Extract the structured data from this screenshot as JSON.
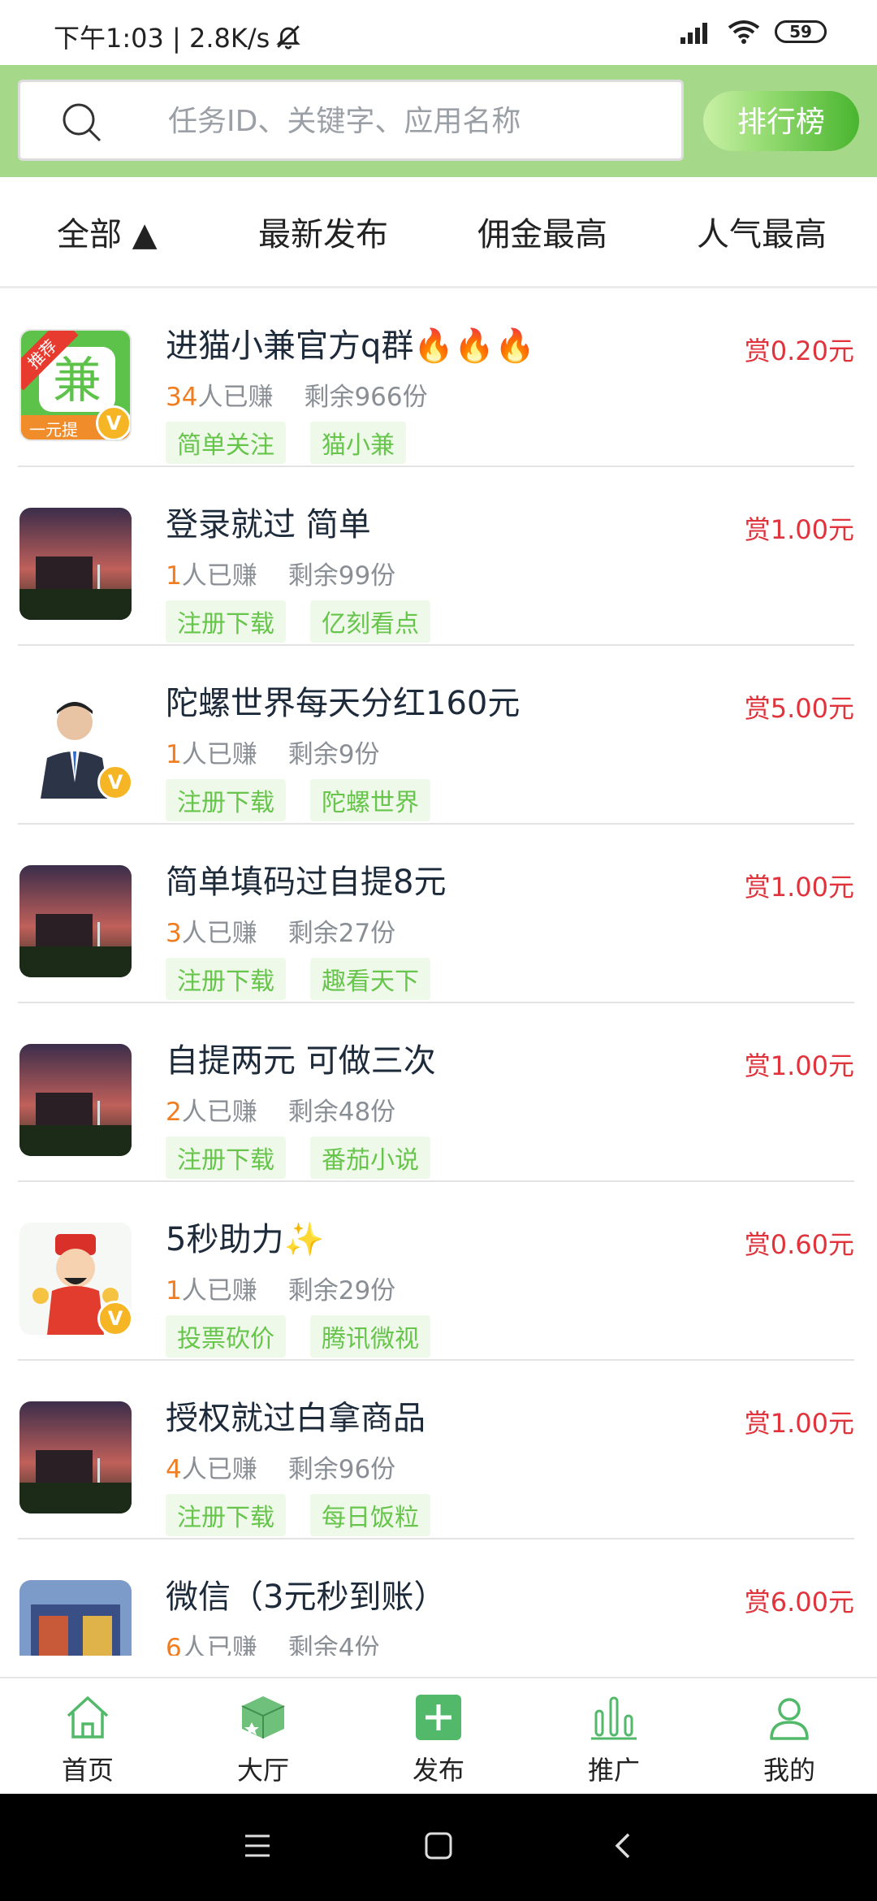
{
  "status_bar": {
    "left_text": "下午1:03 | 2.8K/s",
    "battery": "59",
    "icons": [
      "mute-bell-icon",
      "signal-icon",
      "wifi-icon",
      "battery-icon"
    ]
  },
  "search": {
    "placeholder": "任务ID、关键字、应用名称",
    "rank_button": "排行榜"
  },
  "tabs": [
    {
      "label": "全部 ▲"
    },
    {
      "label": "最新发布"
    },
    {
      "label": "佣金最高"
    },
    {
      "label": "人气最高"
    }
  ],
  "tasks": [
    {
      "title": "进猫小兼官方q群",
      "title_suffix": "🔥🔥🔥",
      "reward": "赏0.20元",
      "count": "34",
      "earned_label": "人已赚",
      "remain": "剩余966份",
      "tags": [
        "简单关注",
        "猫小兼"
      ],
      "thumb": "app-logo-jian",
      "ribbon": "推荐",
      "thumb_caption": "一元提"
    },
    {
      "title": "登录就过 简单",
      "title_suffix": "",
      "reward": "赏1.00元",
      "count": "1",
      "earned_label": "人已赚",
      "remain": "剩余99份",
      "tags": [
        "注册下载",
        "亿刻看点"
      ],
      "thumb": "night-scene"
    },
    {
      "title": "陀螺世界每天分红160元",
      "title_suffix": "",
      "reward": "赏5.00元",
      "count": "1",
      "earned_label": "人已赚",
      "remain": "剩余9份",
      "tags": [
        "注册下载",
        "陀螺世界"
      ],
      "thumb": "businessman"
    },
    {
      "title": "简单填码过自提8元",
      "title_suffix": "",
      "reward": "赏1.00元",
      "count": "3",
      "earned_label": "人已赚",
      "remain": "剩余27份",
      "tags": [
        "注册下载",
        "趣看天下"
      ],
      "thumb": "night-scene"
    },
    {
      "title": "自提两元 可做三次",
      "title_suffix": "",
      "reward": "赏1.00元",
      "count": "2",
      "earned_label": "人已赚",
      "remain": "剩余48份",
      "tags": [
        "注册下载",
        "番茄小说"
      ],
      "thumb": "night-scene"
    },
    {
      "title": "5秒助力",
      "title_suffix": "✨",
      "reward": "赏0.60元",
      "count": "1",
      "earned_label": "人已赚",
      "remain": "剩余29份",
      "tags": [
        "投票砍价",
        "腾讯微视"
      ],
      "thumb": "fortune-god"
    },
    {
      "title": "授权就过白拿商品",
      "title_suffix": "",
      "reward": "赏1.00元",
      "count": "4",
      "earned_label": "人已赚",
      "remain": "剩余96份",
      "tags": [
        "注册下载",
        "每日饭粒"
      ],
      "thumb": "night-scene"
    },
    {
      "title": "微信（3元秒到账）",
      "title_suffix": "",
      "reward": "赏6.00元",
      "count": "6",
      "earned_label": "人已赚",
      "remain": "剩余4份",
      "tags": [],
      "thumb": "storefront"
    }
  ],
  "bottom_nav": [
    {
      "label": "首页",
      "icon": "home-icon"
    },
    {
      "label": "大厅",
      "icon": "box-icon"
    },
    {
      "label": "发布",
      "icon": "plus-icon"
    },
    {
      "label": "推广",
      "icon": "bar-chart-icon"
    },
    {
      "label": "我的",
      "icon": "person-icon"
    }
  ],
  "system_nav": [
    "menu-icon",
    "home-square-icon",
    "back-icon"
  ],
  "colors": {
    "accent_green": "#a6d889",
    "tag_green": "#66c54a",
    "reward_red": "#e0333c",
    "count_orange": "#f07d20",
    "nav_green": "#52b96a"
  }
}
